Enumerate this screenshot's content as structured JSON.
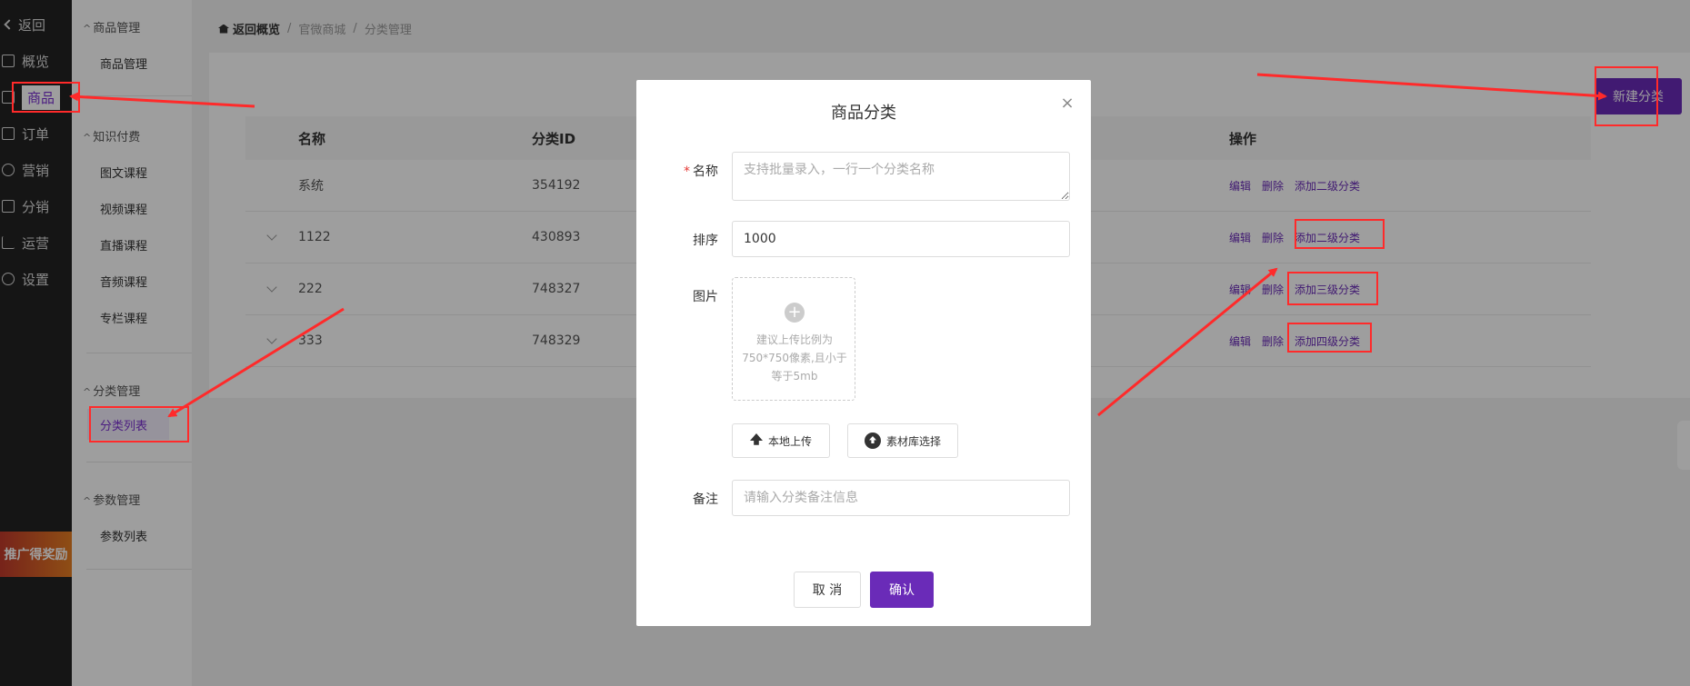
{
  "leftnav": {
    "items": [
      {
        "label": "返回",
        "icon": "chevron-left-icon"
      },
      {
        "label": "概览",
        "icon": "overview-icon"
      },
      {
        "label": "商品",
        "icon": "gift-icon"
      },
      {
        "label": "订单",
        "icon": "order-icon"
      },
      {
        "label": "营销",
        "icon": "marketing-icon"
      },
      {
        "label": "分销",
        "icon": "distribution-icon"
      },
      {
        "label": "运营",
        "icon": "chart-icon"
      },
      {
        "label": "设置",
        "icon": "gear-icon"
      }
    ],
    "promo": "推广得奖励"
  },
  "subnav": {
    "group1": "商品管理",
    "group1_items": [
      "商品管理"
    ],
    "group2": "知识付费",
    "group2_items": [
      "图文课程",
      "视频课程",
      "直播课程",
      "音频课程",
      "专栏课程"
    ],
    "group3": "分类管理",
    "group3_items": [
      "分类列表"
    ],
    "group4": "参数管理",
    "group4_items": [
      "参数列表"
    ]
  },
  "breadcrumb": {
    "home": "返回概览",
    "level1": "官微商城",
    "level2": "分类管理"
  },
  "toolbar": {
    "new_category": "新建分类"
  },
  "table": {
    "headers": [
      "名称",
      "分类ID",
      "操作"
    ],
    "rows": [
      {
        "name": "系统",
        "id": "354192",
        "expandable": false,
        "actions": [
          "编辑",
          "删除",
          "添加二级分类"
        ]
      },
      {
        "name": "1122",
        "id": "430893",
        "expandable": true,
        "actions": [
          "编辑",
          "删除",
          "添加二级分类"
        ]
      },
      {
        "name": "222",
        "id": "748327",
        "expandable": true,
        "actions": [
          "编辑",
          "删除",
          "添加三级分类"
        ]
      },
      {
        "name": "333",
        "id": "748329",
        "expandable": true,
        "actions": [
          "编辑",
          "删除",
          "添加四级分类"
        ]
      }
    ]
  },
  "modal": {
    "title": "商品分类",
    "close": "×",
    "name_label": "名称",
    "required_mark": "*",
    "name_placeholder": "支持批量录入，一行一个分类名称",
    "sort_label": "排序",
    "sort_value": "1000",
    "image_label": "图片",
    "upload_hint": "建议上传比例为750*750像素,且小于等于5mb",
    "local_upload": "本地上传",
    "library_select": "素材库选择",
    "remark_label": "备注",
    "remark_placeholder": "请输入分类备注信息",
    "cancel": "取 消",
    "confirm": "确认"
  },
  "colors": {
    "accent": "#6a2bb8",
    "annotation": "#ff2a2a",
    "nav_bg": "#222222"
  }
}
